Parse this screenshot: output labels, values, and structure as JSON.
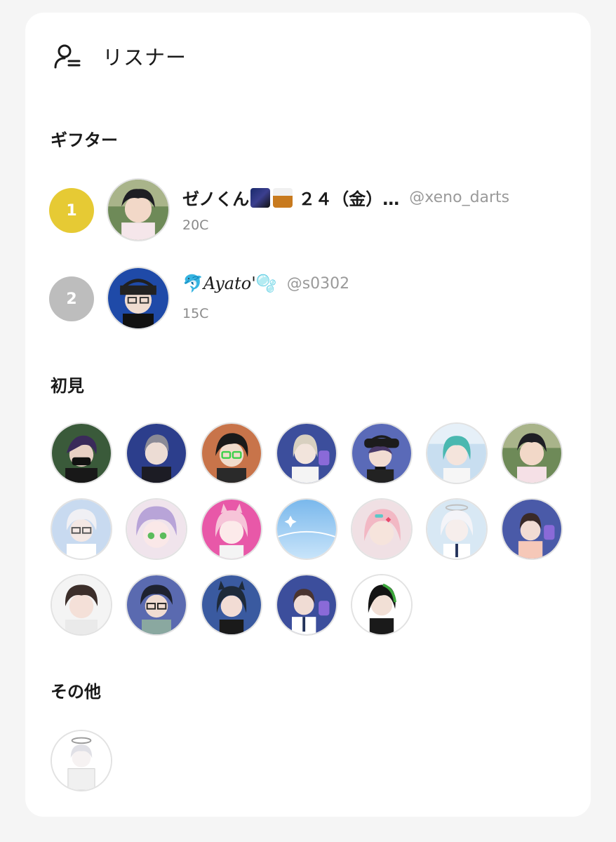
{
  "header": {
    "title": "リスナー",
    "icon": "person-list-icon"
  },
  "sections": {
    "gifters_title": "ギフター",
    "first_time_title": "初見",
    "other_title": "その他"
  },
  "gifters": [
    {
      "rank": "1",
      "name_prefix": "ゼノくん",
      "name_suffix": "２４（金）…",
      "handle": "@xeno_darts",
      "coins": "20C",
      "rank_color": "#e6ca34"
    },
    {
      "rank": "2",
      "name_prefix": "🐬",
      "name_main": "Ayato'",
      "name_suffix": "🫧",
      "handle": "@s0302",
      "coins": "15C",
      "rank_color": "#bdbdbd"
    }
  ]
}
